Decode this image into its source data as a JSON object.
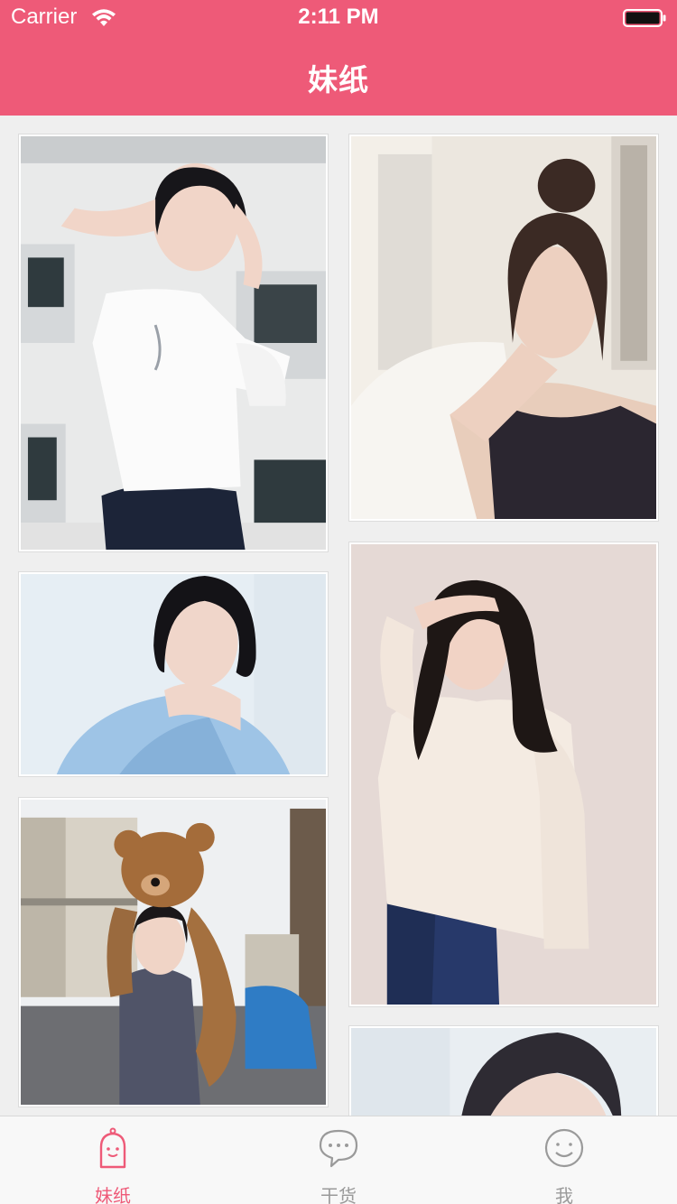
{
  "status_bar": {
    "carrier": "Carrier",
    "time": "2:11 PM"
  },
  "nav": {
    "title": "妹纸"
  },
  "colors": {
    "accent": "#ee5a78",
    "tab_inactive": "#9a9a9a",
    "background": "#efefef"
  },
  "feed": {
    "cards": [
      {
        "subject": "photo-girl-white-blouse-building"
      },
      {
        "subject": "photo-woman-hair-bun-sofa"
      },
      {
        "subject": "photo-girl-bob-blue-shirt"
      },
      {
        "subject": "photo-woman-long-hair-cream-jacket"
      },
      {
        "subject": "photo-girl-teddy-bear-rooftop"
      },
      {
        "subject": "photo-woman-partial-bottom"
      }
    ]
  },
  "tab_bar": {
    "tabs": [
      {
        "label": "妹纸",
        "icon": "ghost-icon",
        "active": true
      },
      {
        "label": "干货",
        "icon": "chat-bubble-icon",
        "active": false
      },
      {
        "label": "我",
        "icon": "smiley-icon",
        "active": false
      }
    ]
  }
}
